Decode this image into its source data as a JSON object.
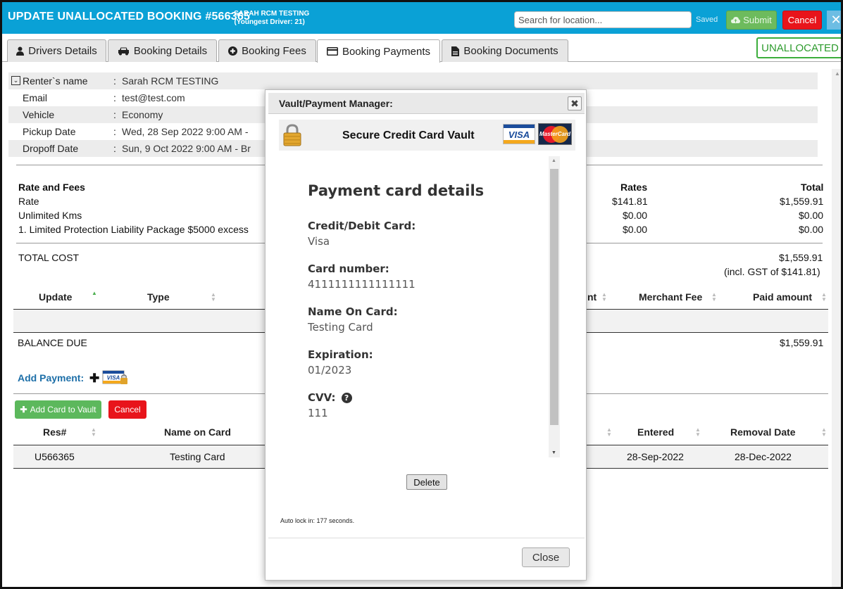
{
  "header": {
    "title": "UPDATE UNALLOCATED BOOKING #566365",
    "subtitle_line1": "- SARAH RCM TESTING",
    "subtitle_line2": "(Youngest Driver: 21)",
    "search_placeholder": "Search for location...",
    "saved_label": "Saved",
    "submit_label": "Submit",
    "cancel_label": "Cancel",
    "close_glyph": "✕"
  },
  "tabs": [
    {
      "label": "Drivers Details",
      "icon": "user-icon"
    },
    {
      "label": "Booking Details",
      "icon": "car-icon"
    },
    {
      "label": "Booking Fees",
      "icon": "plus-circle-icon"
    },
    {
      "label": "Booking Payments",
      "icon": "credit-card-icon",
      "active": true
    },
    {
      "label": "Booking Documents",
      "icon": "document-icon"
    }
  ],
  "status_badge": "UNALLOCATED",
  "renter_info": [
    {
      "label": "Renter`s name",
      "value": "Sarah RCM TESTING"
    },
    {
      "label": "Email",
      "value": "test@test.com"
    },
    {
      "label": "Vehicle",
      "value": "Economy"
    },
    {
      "label": "Pickup Date",
      "value": "Wed, 28 Sep 2022 9:00 AM -"
    },
    {
      "label": "Dropoff Date",
      "value": "Sun, 9 Oct 2022 9:00 AM - Br"
    }
  ],
  "fees": {
    "heading": "Rate and Fees",
    "rates_header": "Rates",
    "total_header": "Total",
    "rows": [
      {
        "label": "Rate",
        "rate": "$141.81",
        "total": "$1,559.91"
      },
      {
        "label": "Unlimited Kms",
        "rate": "$0.00",
        "total": "$0.00"
      },
      {
        "label": "1. Limited Protection Liability Package $5000 excess",
        "rate": "$0.00",
        "total": "$0.00"
      }
    ],
    "total_cost_label": "TOTAL COST",
    "total_cost_value": "$1,559.91",
    "gst_note": "(incl. GST of $141.81)"
  },
  "payments_table": {
    "col_update": "Update",
    "col_type": "Type",
    "col_amount_partial": "nt",
    "col_merchant_fee": "Merchant Fee",
    "col_paid_amount": "Paid amount",
    "balance_due_label": "BALANCE DUE",
    "balance_due_value": "$1,559.91"
  },
  "add_payment": {
    "label": "Add Payment:",
    "add_card_label": "Add Card to Vault",
    "cancel_label": "Cancel"
  },
  "cards_table": {
    "col_res": "Res#",
    "col_name": "Name on Card",
    "col_entered": "Entered",
    "col_removal": "Removal Date",
    "rows": [
      {
        "res": "U566365",
        "name": "Testing Card",
        "entered": "28-Sep-2022",
        "removal": "28-Dec-2022"
      }
    ]
  },
  "modal": {
    "title": "Vault/Payment Manager:",
    "close_glyph": "✖",
    "vault_title": "Secure Credit Card Vault",
    "visa_text": "VISA",
    "mastercard_text": "MasterCard",
    "details_heading": "Payment card details",
    "fields": [
      {
        "label": "Credit/Debit Card:",
        "value": "Visa"
      },
      {
        "label": "Card number:",
        "value": "4111111111111111"
      },
      {
        "label": "Name On Card:",
        "value": "Testing Card"
      },
      {
        "label": "Expiration:",
        "value": "01/2023"
      },
      {
        "label": "CVV:",
        "value": "111"
      }
    ],
    "delete_label": "Delete",
    "autolock_text": "Auto lock in: 177 seconds.",
    "close_label": "Close"
  }
}
